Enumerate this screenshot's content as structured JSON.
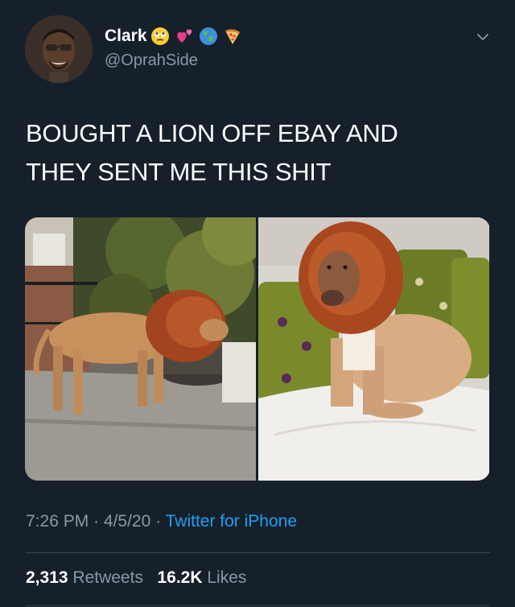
{
  "tweet": {
    "display_name": "Clark",
    "name_emojis": [
      "eye-roll-emoji-icon",
      "two-hearts-emoji-icon",
      "globe-emoji-icon",
      "pizza-emoji-icon"
    ],
    "handle": "@OprahSide",
    "text_line1": "BOUGHT A LION OFF EBAY AND",
    "text_line2": "THEY SENT ME THIS SHIT",
    "time": "7:26 PM",
    "date": "4/5/20",
    "separator": "·",
    "source": "Twitter for iPhone",
    "retweets_count": "2,313",
    "retweets_label": "Retweets",
    "likes_count": "16.2K",
    "likes_label": "Likes"
  },
  "colors": {
    "background": "#15202b",
    "secondary_text": "#8899a6",
    "link": "#1da1f2",
    "divider": "#38444d"
  },
  "media": [
    {
      "subject": "dog-in-lion-mane-standing-on-patio"
    },
    {
      "subject": "dog-in-lion-mane-sitting-on-bed"
    }
  ]
}
